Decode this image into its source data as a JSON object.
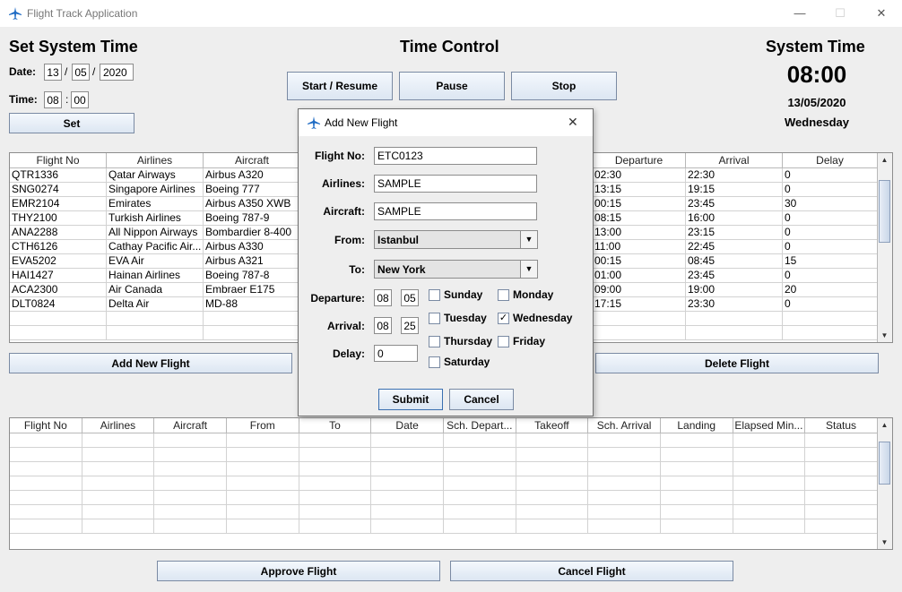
{
  "window": {
    "title": "Flight Track Application",
    "minimize": "—",
    "maximize": "☐",
    "close": "✕"
  },
  "set_time": {
    "heading": "Set System Time",
    "date_label": "Date:",
    "day": "13",
    "sep1": "/",
    "month": "05",
    "sep2": "/",
    "year": "2020",
    "time_label": "Time:",
    "hour": "08",
    "sep3": ":",
    "minute": "00",
    "set_button": "Set"
  },
  "time_control": {
    "heading": "Time Control",
    "start_button": "Start / Resume",
    "pause_button": "Pause",
    "stop_button": "Stop"
  },
  "system_time": {
    "heading": "System Time",
    "time": "08:00",
    "date": "13/05/2020",
    "weekday": "Wednesday"
  },
  "flights_table": {
    "columns": [
      "Flight No",
      "Airlines",
      "Aircraft",
      "Departure",
      "Arrival",
      "Delay"
    ],
    "rows": [
      [
        "QTR1336",
        "Qatar Airways",
        "Airbus A320",
        "02:30",
        "22:30",
        "0"
      ],
      [
        "SNG0274",
        "Singapore Airlines",
        "Boeing 777",
        "13:15",
        "19:15",
        "0"
      ],
      [
        "EMR2104",
        "Emirates",
        "Airbus A350 XWB",
        "00:15",
        "23:45",
        "30"
      ],
      [
        "THY2100",
        "Turkish Airlines",
        "Boeing 787-9",
        "08:15",
        "16:00",
        "0"
      ],
      [
        "ANA2288",
        "All Nippon Airways",
        "Bombardier 8-400",
        "13:00",
        "23:15",
        "0"
      ],
      [
        "CTH6126",
        "Cathay Pacific Air...",
        "Airbus A330",
        "11:00",
        "22:45",
        "0"
      ],
      [
        "EVA5202",
        "EVA Air",
        "Airbus A321",
        "00:15",
        "08:45",
        "15"
      ],
      [
        "HAI1427",
        "Hainan Airlines",
        "Boeing 787-8",
        "01:00",
        "23:45",
        "0"
      ],
      [
        "ACA2300",
        "Air Canada",
        "Embraer E175",
        "09:00",
        "19:00",
        "20"
      ],
      [
        "DLT0824",
        "Delta Air",
        "MD-88",
        "17:15",
        "23:30",
        "0"
      ],
      [
        "",
        "",
        "",
        "",
        "",
        ""
      ],
      [
        "",
        "",
        "",
        "",
        "",
        ""
      ]
    ]
  },
  "add_flight_button": "Add New Flight",
  "delete_flight_button": "Delete Flight",
  "tracking_table": {
    "columns": [
      "Flight No",
      "Airlines",
      "Aircraft",
      "From",
      "To",
      "Date",
      "Sch. Depart...",
      "Takeoff",
      "Sch. Arrival",
      "Landing",
      "Elapsed Min...",
      "Status"
    ],
    "empty_rows": 7
  },
  "approve_button": "Approve Flight",
  "cancel_flight_button": "Cancel Flight",
  "dialog": {
    "title": "Add New Flight",
    "close": "✕",
    "flight_no_label": "Flight No:",
    "flight_no": "ETC0123",
    "airlines_label": "Airlines:",
    "airlines": "SAMPLE",
    "aircraft_label": "Aircraft:",
    "aircraft": "SAMPLE",
    "from_label": "From:",
    "from": "Istanbul",
    "to_label": "To:",
    "to": "New York",
    "departure_label": "Departure:",
    "dep_hour": "08",
    "dep_min": "05",
    "arrival_label": "Arrival:",
    "arr_hour": "08",
    "arr_min": "25",
    "delay_label": "Delay:",
    "delay": "0",
    "days": {
      "sunday": "Sunday",
      "monday": "Monday",
      "tuesday": "Tuesday",
      "wednesday": "Wednesday",
      "thursday": "Thursday",
      "friday": "Friday",
      "saturday": "Saturday",
      "checked_mark": "✓"
    },
    "submit_button": "Submit",
    "cancel_button": "Cancel"
  },
  "colors": {
    "accent": "#1e6bc4",
    "button_top": "#f4f8fd",
    "button_bottom": "#dce6f2",
    "background": "#eeeeee"
  },
  "icons": {
    "app": "airplane-icon",
    "scroll_up": "▲",
    "scroll_down": "▼",
    "combo_arrow": "▼"
  }
}
